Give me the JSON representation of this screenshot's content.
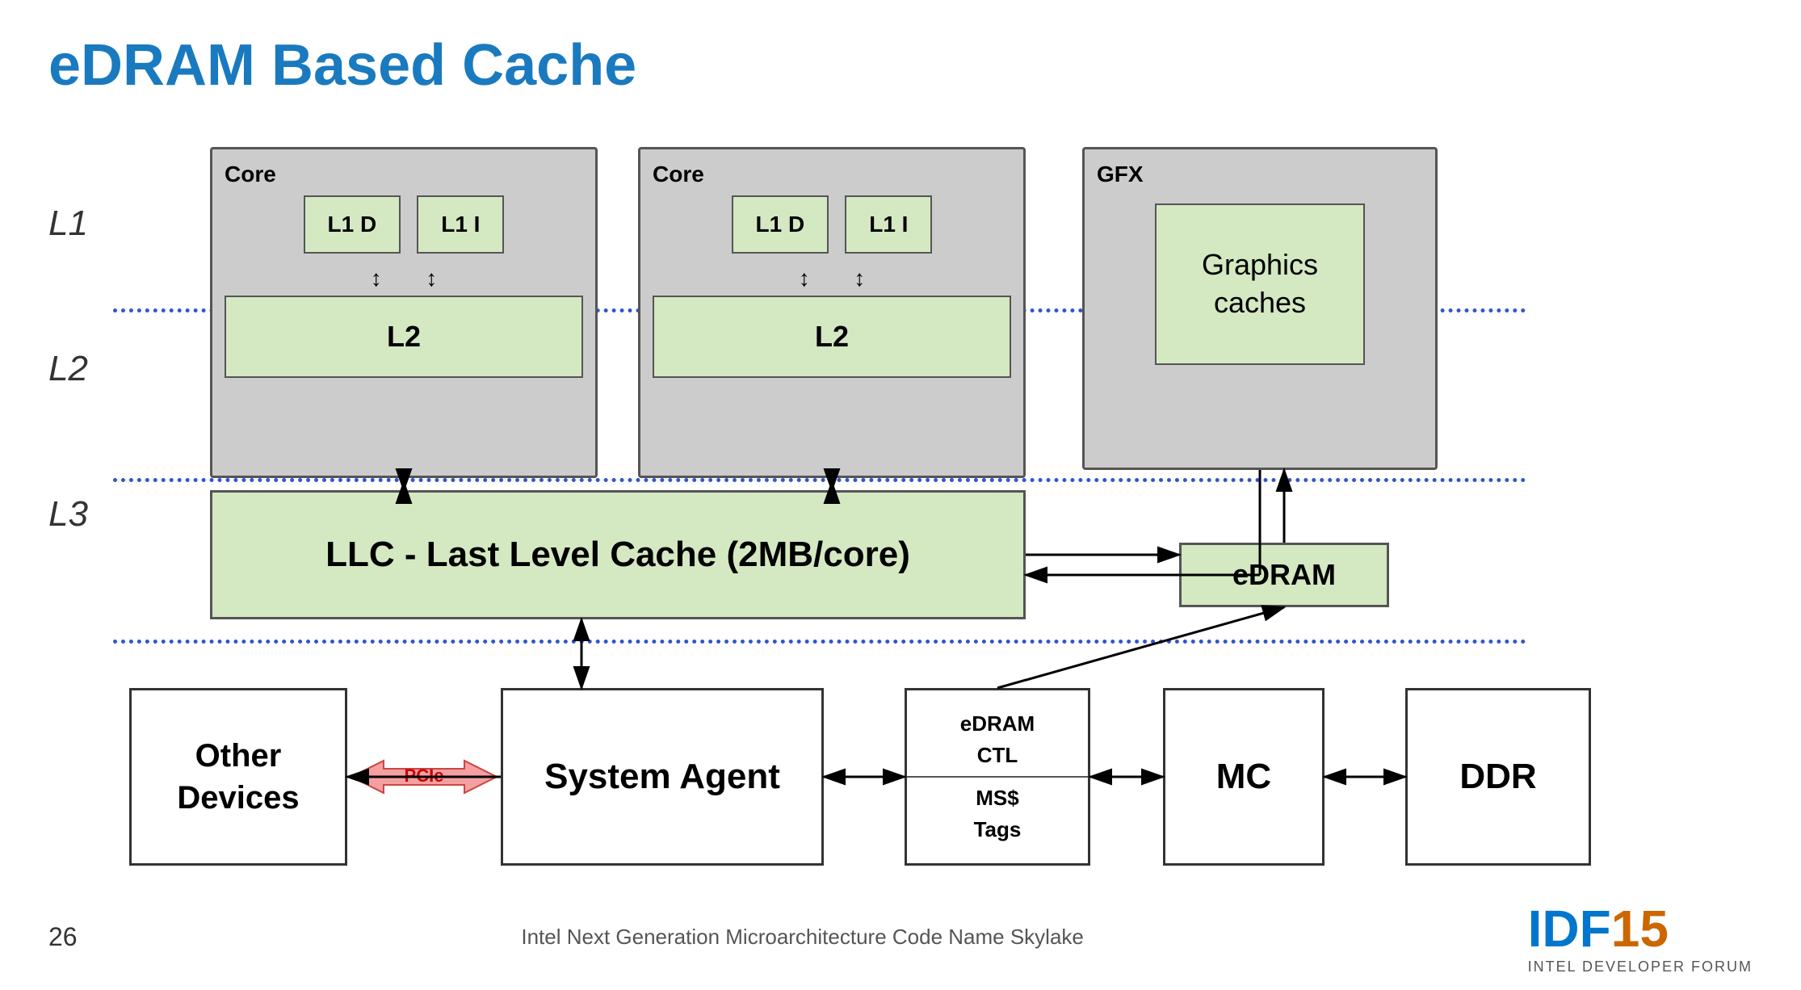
{
  "title": "eDRAM Based Cache",
  "labels": {
    "l1": "L1",
    "l2": "L2",
    "l3": "L3",
    "core1": "Core",
    "core2": "Core",
    "gfx": "GFX",
    "l1d": "L1 D",
    "l1i": "L1 I",
    "l2_chip": "L2",
    "graphics_caches": "Graphics\ncaches",
    "llc": "LLC - Last Level Cache (2MB/core)",
    "edram": "eDRAM",
    "other_devices": "Other Devices",
    "pcie": "PCIe",
    "system_agent": "System Agent",
    "edram_ctl_line1": "eDRAM",
    "edram_ctl_line2": "CTL",
    "ms_tags": "MS$\nTags",
    "mc": "MC",
    "ddr": "DDR"
  },
  "footer": {
    "page": "26",
    "text": "Intel Next Generation Microarchitecture Code Name Skylake",
    "logo_idf": "IDF",
    "logo_15": "15",
    "logo_sub": "INTEL DEVELOPER FORUM"
  }
}
